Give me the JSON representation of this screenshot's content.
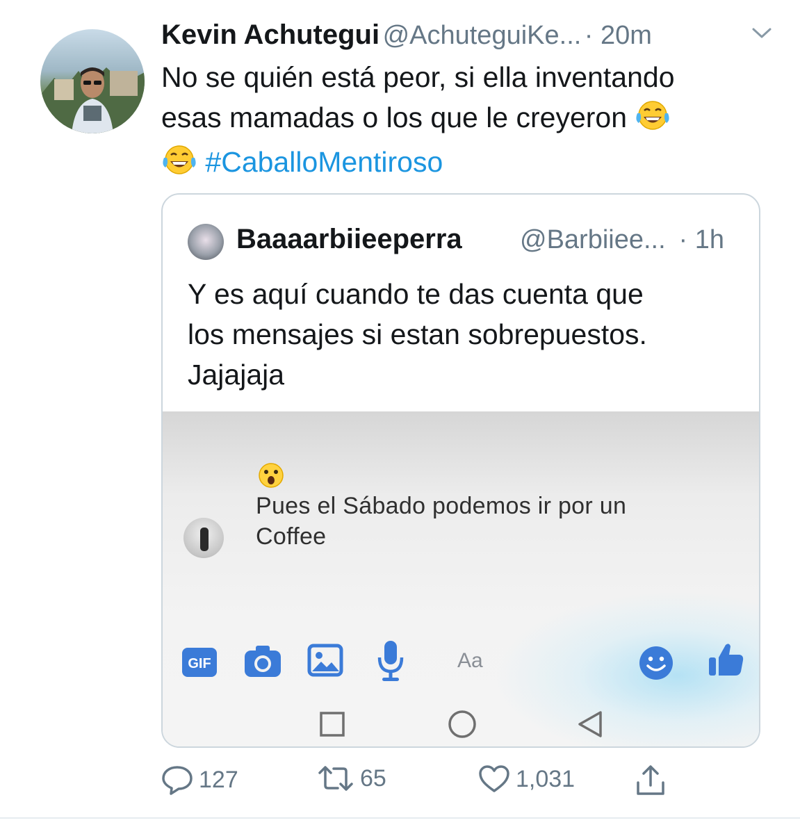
{
  "tweet": {
    "author_name": "Kevin Achutegui",
    "author_handle": "@AchuteguiKe...",
    "time": "· 20m",
    "text_line1": "No se quién está peor, si ella inventando",
    "text_line2": "esas mamadas o los que le creyeron",
    "hashtag": "#CaballoMentiroso",
    "emoji": "face-with-tears-of-joy"
  },
  "quoted_tweet": {
    "author_name": "Baaaarbiieeperra",
    "author_handle": "@Barbiiee...",
    "time": "· 1h",
    "text_line1": "Y es aquí cuando te das cuenta que",
    "text_line2": "los mensajes si estan sobrepuestos.",
    "text_line3": "Jajajaja",
    "screenshot": {
      "reaction_emoji": "surprised-face",
      "message_line1": "Pues el Sábado podemos ir por un",
      "message_line2": "Coffee",
      "gif_label": "GIF",
      "input_placeholder": "Aa",
      "toolbar_icons": [
        "gif-icon",
        "camera-icon",
        "image-icon",
        "microphone-icon",
        "smiley-icon",
        "thumbs-up-icon"
      ],
      "nav_icons": [
        "square-icon",
        "circle-icon",
        "back-triangle-icon"
      ]
    }
  },
  "actions": {
    "replies": "127",
    "retweets": "65",
    "likes": "1,031"
  },
  "colors": {
    "link": "#1b95e0",
    "secondary_text": "#657786",
    "messenger_blue": "#3b7bd8"
  }
}
